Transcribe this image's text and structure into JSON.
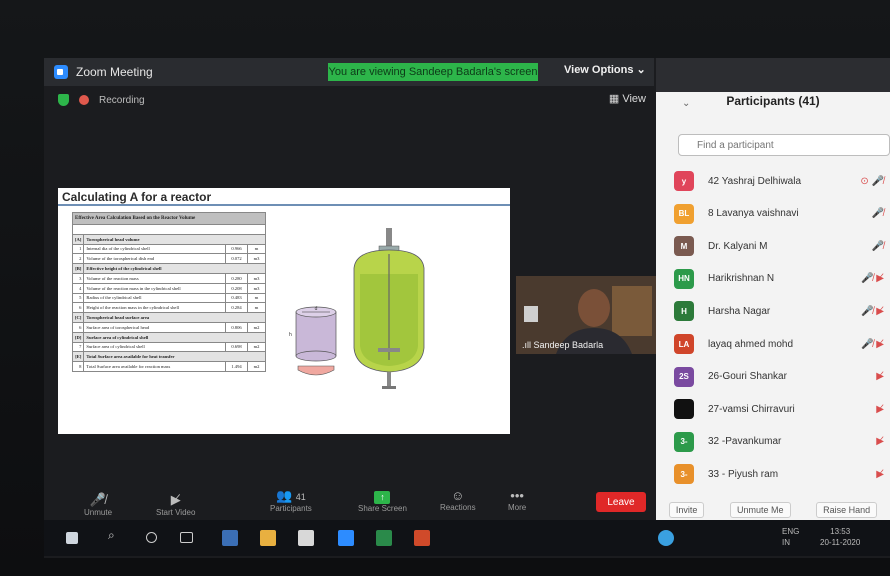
{
  "window": {
    "title": "Zoom Meeting",
    "viewing_banner": "You are viewing Sandeep Badarla's screen",
    "view_options": "View Options ⌄"
  },
  "meeting": {
    "recording_label": "Recording",
    "view_label": "View"
  },
  "slide": {
    "title": "Calculating A for a reactor",
    "table_heading": "Effective Area Calculation Based on the Reactor Volume",
    "rows": [
      {
        "kind": "sec",
        "num": "[A]",
        "label": "Torospherical head volume",
        "value": "",
        "unit": ""
      },
      {
        "kind": "row",
        "num": "1",
        "label": "Internal dia of the cylindrical shell",
        "value": "0.966",
        "unit": "m"
      },
      {
        "kind": "row",
        "num": "2",
        "label": "Volume of the torospherical dish end",
        "value": "0.072",
        "unit": "m3"
      },
      {
        "kind": "sec",
        "num": "[B]",
        "label": "Effective height of the cylindrical shell",
        "value": "",
        "unit": ""
      },
      {
        "kind": "row",
        "num": "3",
        "label": "Volume of the reaction mass",
        "value": "0.280",
        "unit": "m3"
      },
      {
        "kind": "row",
        "num": "4",
        "label": "Volume of the reaction mass in the cylindrical shell",
        "value": "0.208",
        "unit": "m3"
      },
      {
        "kind": "row",
        "num": "5",
        "label": "Radius of the cylindrical shell",
        "value": "0.483",
        "unit": "m"
      },
      {
        "kind": "row",
        "num": "6",
        "label": "Height of the reaction mass in the cylindrical shell",
        "value": "0.284",
        "unit": "m"
      },
      {
        "kind": "sec",
        "num": "[C]",
        "label": "Torospherical head surface area",
        "value": "",
        "unit": ""
      },
      {
        "kind": "row",
        "num": "6",
        "label": "Surface area of torospherical head",
        "value": "0.806",
        "unit": "m2"
      },
      {
        "kind": "sec",
        "num": "[D]",
        "label": "Surface area of cylindrical shell",
        "value": "",
        "unit": ""
      },
      {
        "kind": "row",
        "num": "7",
        "label": "Surface area of cylindrical shell",
        "value": "0.698",
        "unit": "m2"
      },
      {
        "kind": "sec",
        "num": "[E]",
        "label": "Total Surface area available for heat transfer",
        "value": "",
        "unit": ""
      },
      {
        "kind": "row",
        "num": "8",
        "label": "Total Surface area available for reaction mass",
        "value": "1.494",
        "unit": "m2"
      }
    ],
    "diagram_label_d": "d",
    "diagram_label_h": "h"
  },
  "video": {
    "name": "Sandeep Badarla"
  },
  "toolbar": {
    "participants_count": "41",
    "leave_label": "Leave",
    "share_label": "Share Screen",
    "reactions_label": "Reactions",
    "more_label": "More",
    "participants_label": "Participants",
    "start_video_label": "Start Video",
    "unmute_label": "Unmute"
  },
  "participants": {
    "title": "Participants (41)",
    "search_placeholder": "Find a participant",
    "people": [
      {
        "initials": "y",
        "color": "#e0455a",
        "name": "42 Yashraj Delhiwala"
      },
      {
        "initials": "BL",
        "color": "#f0a030",
        "name": "8  Lavanya vaishnavi"
      },
      {
        "initials": "M",
        "color": "#7a5a50",
        "name": "Dr. Kalyani M"
      },
      {
        "initials": "HN",
        "color": "#2c9a4a",
        "name": "Harikrishnan N"
      },
      {
        "initials": "H",
        "color": "#2c7a3a",
        "name": "Harsha Nagar"
      },
      {
        "initials": "LA",
        "color": "#d0452a",
        "name": "layaq ahmed mohd"
      },
      {
        "initials": "2S",
        "color": "#7a4aa0",
        "name": "26-Gouri Shankar"
      },
      {
        "initials": "",
        "color": "#111111",
        "name": "27-vamsi Chirravuri"
      },
      {
        "initials": "3-",
        "color": "#2c9a4a",
        "name": "32 -Pavankumar"
      },
      {
        "initials": "3-",
        "color": "#e8902a",
        "name": "33 - Piyush ram"
      }
    ],
    "invite": "Invite",
    "unmute_me": "Unmute Me",
    "raise_hand": "Raise Hand"
  },
  "taskbar": {
    "lang_top": "ENG",
    "lang_bottom": "IN",
    "time": "13:53",
    "date": "20-11-2020"
  },
  "colors": {
    "accent_green": "#2db54a",
    "leave_red": "#e02828",
    "zoom_blue": "#2d8cff"
  }
}
